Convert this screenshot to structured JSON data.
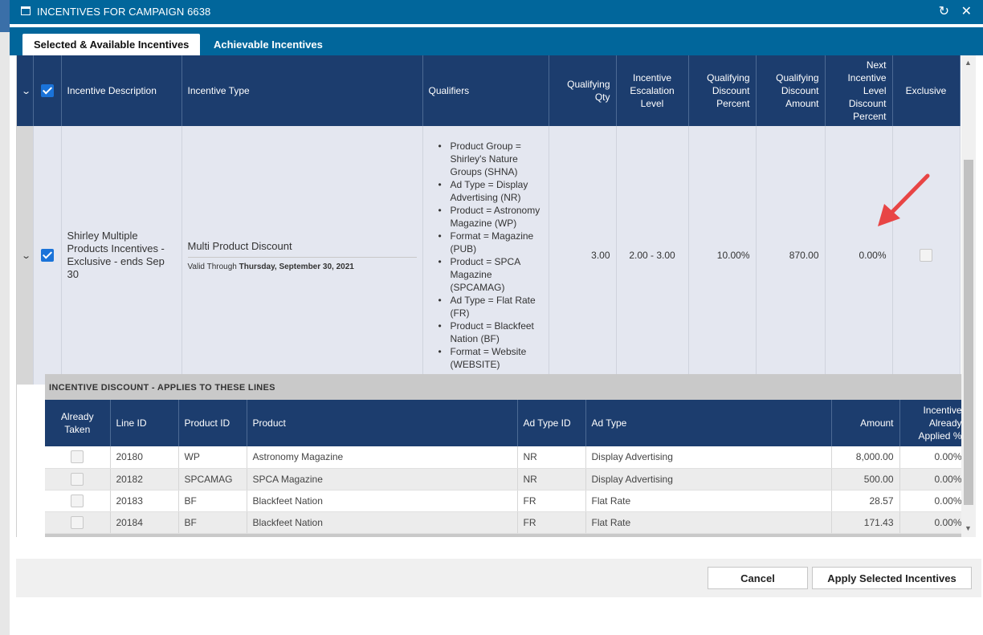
{
  "window": {
    "title": "INCENTIVES FOR CAMPAIGN 6638"
  },
  "tabs": [
    {
      "label": "Selected & Available Incentives",
      "active": true
    },
    {
      "label": "Achievable Incentives",
      "active": false
    }
  ],
  "main_grid": {
    "headers": {
      "description": "Incentive Description",
      "type": "Incentive Type",
      "qualifiers": "Qualifiers",
      "qualifying_qty": "Qualifying Qty",
      "escalation_level": "Incentive Escalation Level",
      "qualifying_discount_percent": "Qualifying Discount Percent",
      "qualifying_discount_amount": "Qualifying Discount Amount",
      "next_level_discount_percent": "Next Incentive Level Discount Percent",
      "exclusive": "Exclusive"
    },
    "row": {
      "selected": true,
      "description": "Shirley Multiple Products Incentives - Exclusive - ends Sep 30",
      "type": "Multi Product Discount",
      "valid_through_label": "Valid Through",
      "valid_through_date": "Thursday, September 30, 2021",
      "qualifiers": [
        "Product Group = Shirley's Nature Groups (SHNA)",
        "Ad Type = Display Advertising (NR)",
        "Product = Astronomy Magazine (WP)",
        "Format = Magazine (PUB)",
        "Product = SPCA Magazine (SPCAMAG)",
        "Ad Type = Flat Rate (FR)",
        "Product = Blackfeet Nation (BF)",
        "Format = Website (WEBSITE)"
      ],
      "qualifying_qty": "3.00",
      "escalation_level": "2.00 - 3.00",
      "qualifying_discount_percent": "10.00%",
      "qualifying_discount_amount": "870.00",
      "next_level_discount_percent": "0.00%",
      "exclusive": false
    }
  },
  "sub_section": {
    "title": "INCENTIVE DISCOUNT - APPLIES TO THESE LINES",
    "headers": {
      "already_taken": "Already Taken",
      "line_id": "Line ID",
      "product_id": "Product ID",
      "product": "Product",
      "ad_type_id": "Ad Type ID",
      "ad_type": "Ad Type",
      "amount": "Amount",
      "applied_percent": "Incentive Already Applied %"
    },
    "rows": [
      {
        "line_id": "20180",
        "product_id": "WP",
        "product": "Astronomy Magazine",
        "ad_type_id": "NR",
        "ad_type": "Display Advertising",
        "amount": "8,000.00",
        "applied_percent": "0.00%"
      },
      {
        "line_id": "20182",
        "product_id": "SPCAMAG",
        "product": "SPCA Magazine",
        "ad_type_id": "NR",
        "ad_type": "Display Advertising",
        "amount": "500.00",
        "applied_percent": "0.00%"
      },
      {
        "line_id": "20183",
        "product_id": "BF",
        "product": "Blackfeet Nation",
        "ad_type_id": "FR",
        "ad_type": "Flat Rate",
        "amount": "28.57",
        "applied_percent": "0.00%"
      },
      {
        "line_id": "20184",
        "product_id": "BF",
        "product": "Blackfeet Nation",
        "ad_type_id": "FR",
        "ad_type": "Flat Rate",
        "amount": "171.43",
        "applied_percent": "0.00%"
      }
    ]
  },
  "footer": {
    "cancel_label": "Cancel",
    "apply_label": "Apply Selected Incentives"
  },
  "icons": {
    "window": "window-icon",
    "refresh": "refresh-icon",
    "close": "close-icon",
    "expand": "chevron-down-icon",
    "annotation": "red-arrow-annotation"
  },
  "colors": {
    "title_bar": "#01669b",
    "grid_header": "#1c3d6e",
    "row_background": "#e4e7f0",
    "checkbox_accent": "#1a73d9",
    "annotation_arrow": "#e84545"
  }
}
